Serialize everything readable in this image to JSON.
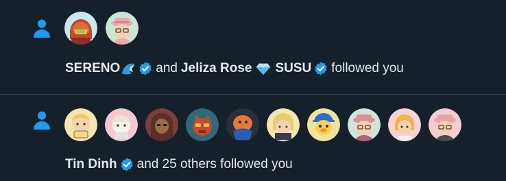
{
  "notifications": [
    {
      "icon": "person-icon",
      "avatars": [
        {
          "name": "armored-helmet-avatar",
          "bg": "#c8e7ef"
        },
        {
          "name": "pink-hat-avatar",
          "bg": "#c9e6d6"
        }
      ],
      "text": {
        "user1": "SERENO",
        "user1_emoji": "wave-emoji",
        "and": "and",
        "user2": "Jeliza Rose",
        "user2_emoji": "gem-emoji",
        "user3": "SUSU",
        "followed": "followed you"
      }
    },
    {
      "icon": "person-icon",
      "avatars": [
        {
          "name": "avatar-1",
          "bg": "#f4e6b0"
        },
        {
          "name": "avatar-2",
          "bg": "#f3c9cf"
        },
        {
          "name": "avatar-3",
          "bg": "#7a3f3a"
        },
        {
          "name": "avatar-4",
          "bg": "#2f6a78"
        },
        {
          "name": "avatar-5",
          "bg": "#2a2f3a"
        },
        {
          "name": "avatar-6",
          "bg": "#f4e6b0"
        },
        {
          "name": "avatar-7",
          "bg": "#f0e3a0"
        },
        {
          "name": "avatar-8",
          "bg": "#cfe3d7"
        },
        {
          "name": "avatar-9",
          "bg": "#f5d2d6"
        },
        {
          "name": "avatar-10",
          "bg": "#f3cdd3"
        }
      ],
      "text": {
        "user1": "Tin Dinh",
        "rest": "and 25 others followed you"
      }
    }
  ],
  "colors": {
    "background": "#15202b",
    "accent": "#1d9bf0",
    "divider": "#38444d",
    "text": "#e7e9ea"
  }
}
